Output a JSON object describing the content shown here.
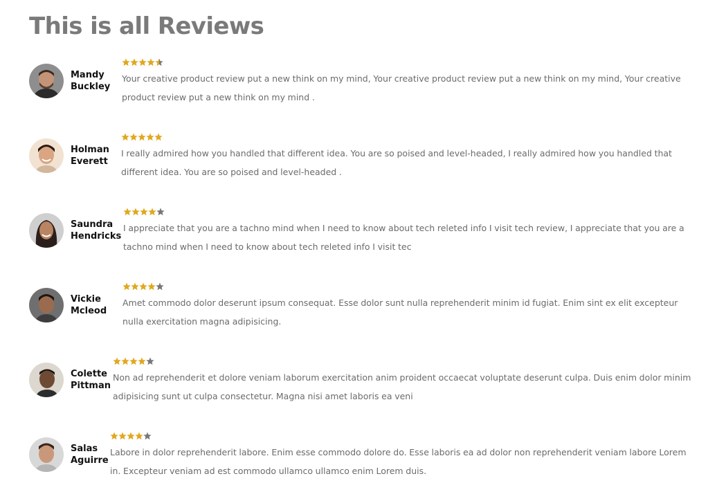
{
  "page": {
    "title": "This is all Reviews"
  },
  "colors": {
    "star_filled": "#e0a81f",
    "star_empty": "#777777"
  },
  "reviews": [
    {
      "first_name": "Mandy",
      "last_name": "Buckley",
      "rating": 4.5,
      "text": "Your creative product review put a new think on my mind, Your creative product review put a new think on my mind, Your creative product review put a new think on my mind ."
    },
    {
      "first_name": "Holman",
      "last_name": "Everett",
      "rating": 5,
      "text": "I really admired how you handled that different idea. You are so poised and level-headed, I really admired how you handled that different idea. You are so poised and level-headed ."
    },
    {
      "first_name": "Saundra",
      "last_name": "Hendricks",
      "rating": 4,
      "text": "I appreciate that you are a tachno mind when I need to know about tech releted info I visit tech review, I appreciate that you are a tachno mind when I need to know about tech releted info I visit tec"
    },
    {
      "first_name": "Vickie",
      "last_name": "Mcleod",
      "rating": 4,
      "text": "Amet commodo dolor deserunt ipsum consequat. Esse dolor sunt nulla reprehenderit minim id fugiat. Enim sint ex elit excepteur nulla exercitation magna adipisicing."
    },
    {
      "first_name": "Colette",
      "last_name": "Pittman",
      "rating": 4,
      "text": "Non ad reprehenderit et dolore veniam laborum exercitation anim proident occaecat voluptate deserunt culpa. Duis enim dolor minim adipisicing sunt ut culpa consectetur. Magna nisi amet laboris ea veni"
    },
    {
      "first_name": "Salas",
      "last_name": "Aguirre",
      "rating": 4,
      "text": "Labore in dolor reprehenderit labore. Enim esse commodo dolore do. Esse laboris ea ad dolor non reprehenderit veniam labore Lorem in. Excepteur veniam ad est commodo ullamco ullamco enim Lorem duis."
    }
  ]
}
